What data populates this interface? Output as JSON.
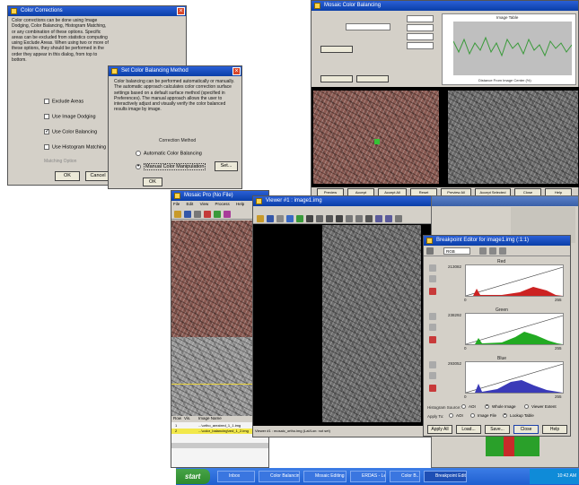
{
  "color_corrections": {
    "title": "Color Corrections",
    "description": "Color corrections can be done using Image Dodging, Color Balancing, Histogram Matching, or any combination of these options. Specific areas can be excluded from statistics computing using Exclude Areas. When using two or more of these options, they should be performed in the order they appear in this dialog, from top to bottom.",
    "options": [
      {
        "label": "Exclude Areas",
        "checked": false
      },
      {
        "label": "Use Image Dodging",
        "checked": false
      },
      {
        "label": "Use Color Balancing",
        "checked": true
      },
      {
        "label": "Use Histogram Matching",
        "checked": false
      }
    ],
    "field_label": "Matching Option",
    "ok": "OK",
    "cancel": "Cancel"
  },
  "set_color_balancing": {
    "title": "Set Color Balancing Method",
    "description": "Color balancing can be performed automatically or manually. The automatic approach calculates color correction surface settings based on a default surface method (specified in Preferences). The manual approach allows the user to interactively adjust and visually verify the color balanced results image by image.",
    "group_label": "Correction Method",
    "options": [
      {
        "label": "Automatic Color Balancing",
        "selected": false
      },
      {
        "label": "Manual Color Manipulation",
        "selected": true
      }
    ],
    "set_button": "Set...",
    "ok_button": "OK"
  },
  "color_balancing_window": {
    "title": "Mosaic Color Balancing",
    "graph_title": "Image Table",
    "graph_xlabel": "Distance From Image Center (%)",
    "bottom_buttons": [
      "Preview",
      "Accept",
      "Accept All",
      "Reset",
      "Preview All",
      "Accept Selected",
      "Close",
      "Help"
    ]
  },
  "mosaic_viewer": {
    "title": "Mosaic Pro (No File)",
    "menu": [
      "File",
      "Edit",
      "View",
      "Process",
      "Help"
    ],
    "table_headers": [
      "Row",
      "Vis.",
      "Image Name"
    ],
    "table_rows": [
      {
        "row": "1",
        "name": "...\\ortho_area\\red_1_1.img"
      },
      {
        "row": "2",
        "name": "...\\color_balancing\\red_1_2.img"
      }
    ]
  },
  "viewer": {
    "title": "Viewer #1 : image1.img",
    "status": "Viewer #1 : mosaic_ortho.img    (Lat/Lon: not set)"
  },
  "breakpoint_editor": {
    "title": "Breakpoint Editor for image1.img (:1:1)",
    "band_selector": "RGB",
    "bands": [
      {
        "name": "Red",
        "max_label": "213082",
        "color": "#cc2222"
      },
      {
        "name": "Green",
        "max_label": "238292",
        "color": "#22aa22"
      },
      {
        "name": "Blue",
        "max_label": "293052",
        "color": "#3a3ab8"
      }
    ],
    "axis_min": "0",
    "axis_max": "255",
    "histogram_source_label": "Histogram Source:",
    "histogram_source_options": [
      {
        "label": "AOI",
        "selected": false
      },
      {
        "label": "Whole Image",
        "selected": true
      },
      {
        "label": "Viewer Extent",
        "selected": false
      }
    ],
    "apply_to_label": "Apply To:",
    "apply_to_options": [
      {
        "label": "AOI",
        "selected": false
      },
      {
        "label": "Image File",
        "selected": false
      },
      {
        "label": "Lookup Table",
        "selected": true
      }
    ],
    "buttons": [
      "Apply All",
      "Load...",
      "Save...",
      "Close",
      "Help"
    ]
  },
  "taskbar": {
    "start": "start",
    "tasks": [
      "Inbox",
      "Color Balancing",
      "Mosaic Editing",
      "ERDAS - Leica",
      "Color B...",
      "Breakpoint Editor"
    ],
    "tray_time": "10:42 AM"
  }
}
